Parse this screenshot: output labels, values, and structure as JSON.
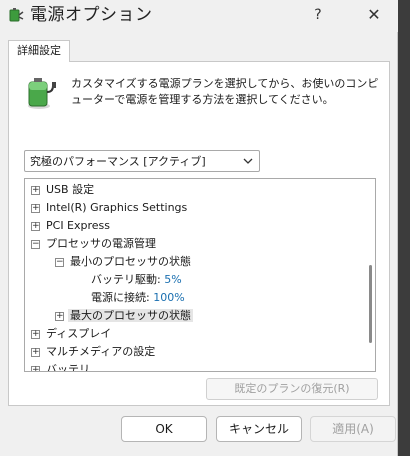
{
  "window": {
    "title": "電源オプション",
    "help_glyph": "?",
    "close_glyph": "✕"
  },
  "tabs": [
    {
      "label": "詳細設定"
    }
  ],
  "description": "カスタマイズする電源プランを選択してから、お使いのコンピューターで電源を管理する方法を選択してください。",
  "plan_select": {
    "value": "究極のパフォーマンス [アクティブ]"
  },
  "tree": [
    {
      "label": "USB 設定",
      "state": "collapsed",
      "level": 0
    },
    {
      "label": "Intel(R) Graphics Settings",
      "state": "collapsed",
      "level": 0
    },
    {
      "label": "PCI Express",
      "state": "collapsed",
      "level": 0
    },
    {
      "label": "プロセッサの電源管理",
      "state": "expanded",
      "level": 0
    },
    {
      "label": "最小のプロセッサの状態",
      "state": "expanded",
      "level": 1
    },
    {
      "label": "バッテリ駆動:",
      "value": "5%",
      "level": 2
    },
    {
      "label": "電源に接続:",
      "value": "100%",
      "level": 2
    },
    {
      "label": "最大のプロセッサの状態",
      "state": "collapsed",
      "level": 1
    },
    {
      "label": "ディスプレイ",
      "state": "collapsed",
      "level": 0
    },
    {
      "label": "マルチメディアの設定",
      "state": "collapsed",
      "level": 0
    },
    {
      "label": "バッテリ",
      "state": "collapsed",
      "level": 0
    }
  ],
  "buttons": {
    "restore_defaults": "既定のプランの復元(R)",
    "ok": "OK",
    "cancel": "キャンセル",
    "apply": "適用(A)"
  },
  "icons": {
    "app": "power-options-icon",
    "battery": "battery-plug-icon"
  },
  "colors": {
    "value_text": "#1a6fb0",
    "panel_bg": "#ffffff",
    "dialog_bg": "#f0f0f0"
  }
}
